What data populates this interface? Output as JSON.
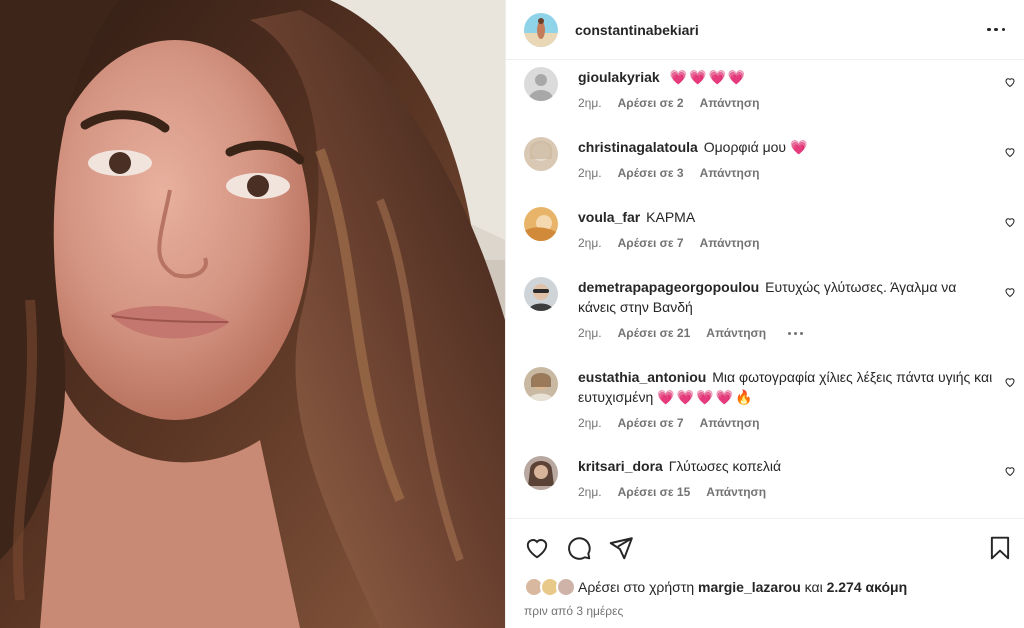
{
  "post": {
    "author": "constantinabekiari",
    "photo_alt": "selfie"
  },
  "comments": [
    {
      "user": "gioulakyriak",
      "text": "",
      "hearts": "💗💗💗💗",
      "age": "2ημ.",
      "likes": "Αρέσει σε 2",
      "reply": "Απάντηση"
    },
    {
      "user": "christinagalatoula",
      "text": "Ομορφιά μου",
      "hearts": "💗",
      "age": "2ημ.",
      "likes": "Αρέσει σε 3",
      "reply": "Απάντηση"
    },
    {
      "user": "voula_far",
      "text": "ΚΑΡΜΑ",
      "hearts": "",
      "age": "2ημ.",
      "likes": "Αρέσει σε 7",
      "reply": "Απάντηση"
    },
    {
      "user": "demetrapapageorgopoulou",
      "text": "Ευτυχώς γλύτωσες. Άγαλμα να κάνεις στην Βανδή",
      "hearts": "",
      "age": "2ημ.",
      "likes": "Αρέσει σε 21",
      "reply": "Απάντηση"
    },
    {
      "user": "eustathia_antoniou",
      "text": "Μια φωτογραφία χίλιες λέξεις πάντα υγιής και ευτυχισμένη",
      "hearts": "💗💗💗💗🔥",
      "age": "2ημ.",
      "likes": "Αρέσει σε 7",
      "reply": "Απάντηση"
    },
    {
      "user": "kritsari_dora",
      "text": "Γλύτωσες κοπελιά",
      "hearts": "",
      "age": "2ημ.",
      "likes": "Αρέσει σε 15",
      "reply": "Απάντηση"
    }
  ],
  "likes": {
    "prefix": "Αρέσει στο χρήστη",
    "user": "margie_lazarou",
    "joiner": "και",
    "count": "2.274 ακόμη"
  },
  "timestamp": "πριν από 3 ημέρες",
  "icons": {
    "like": "heart-outline-icon",
    "comment": "comment-bubble-icon",
    "share": "paper-plane-icon",
    "save": "bookmark-icon",
    "more": "more-horizontal-icon"
  },
  "colors": {
    "heart": "#f0357b",
    "muted": "#737373",
    "text": "#262626",
    "border": "#efefef"
  }
}
